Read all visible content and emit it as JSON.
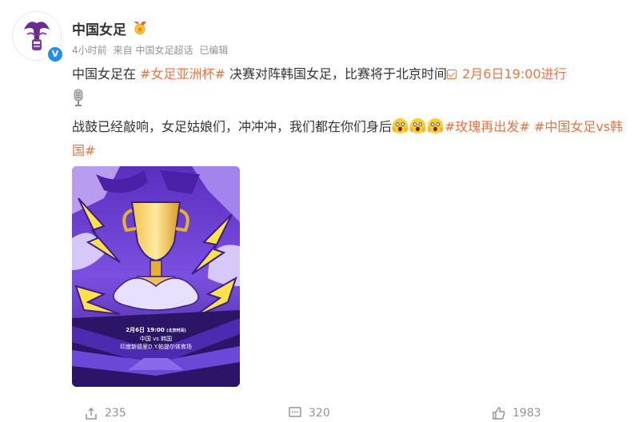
{
  "post": {
    "author": "中国女足",
    "time": "4小时前",
    "source_prefix": "来自",
    "source": "中国女足超话",
    "edited": "已编辑",
    "line1_prefix": "中国女足在 ",
    "tag_asian_cup": "#女足亚洲杯#",
    "line1_mid": " 决赛对阵韩国女足，比赛将于北京时间",
    "match_time": "2月6日19:00进行",
    "line2_text": "战鼓已经敲响，女足姑娘们，冲冲冲，我们都在你们身后",
    "tag_rose": "#玫瑰再出发#",
    "tag_china_vs_korea": " #中国女足vs韩国#"
  },
  "poster": {
    "date_line": "2月6日  19:00",
    "date_note": "(北京时间)",
    "teams": "中国 vs 韩国",
    "venue": "印度新德里D.Y.帕提尔体育场"
  },
  "actions": {
    "repost_count": "235",
    "comment_count": "320",
    "like_count": "1983"
  },
  "colors": {
    "tag": "#eb7340",
    "meta": "#939393",
    "verified": "#1f8ff0",
    "poster_purple": "#6b3fd6"
  },
  "icons": [
    "verified-icon",
    "medal-icon",
    "check-box-icon",
    "microphone-icon",
    "scream-emoji",
    "repost-icon",
    "comment-icon",
    "like-icon"
  ]
}
